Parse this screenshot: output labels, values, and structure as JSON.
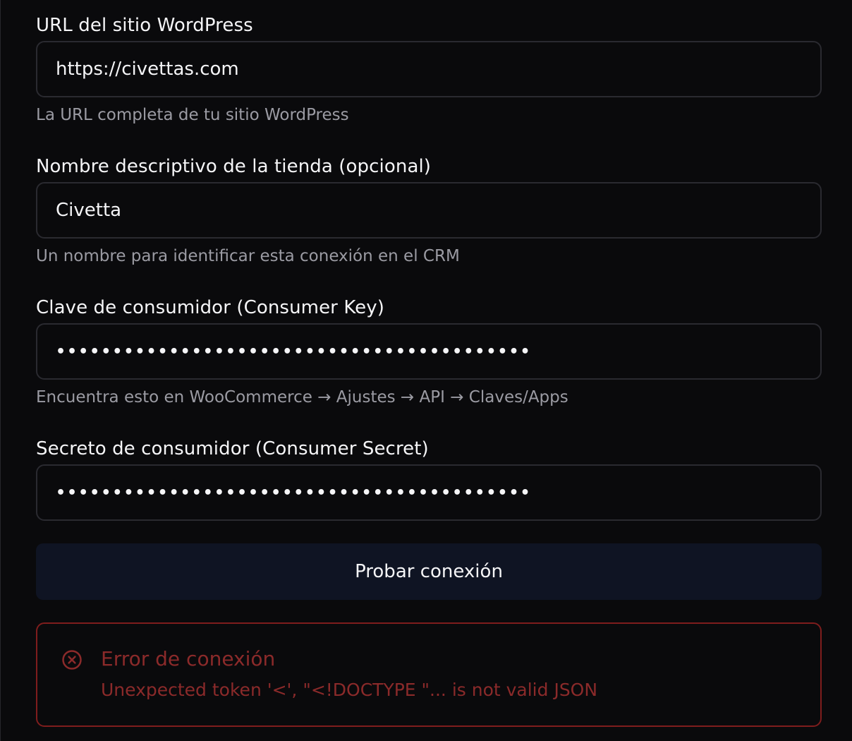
{
  "form": {
    "url": {
      "label": "URL del sitio WordPress",
      "value": "https://civettas.com",
      "hint": "La URL completa de tu sitio WordPress"
    },
    "store_name": {
      "label": "Nombre descriptivo de la tienda (opcional)",
      "value": "Civetta",
      "hint": "Un nombre para identificar esta conexión en el CRM"
    },
    "consumer_key": {
      "label": "Clave de consumidor (Consumer Key)",
      "value": "••••••••••••••••••••••••••••••••••••••••••",
      "hint": "Encuentra esto en WooCommerce → Ajustes → API → Claves/Apps"
    },
    "consumer_secret": {
      "label": "Secreto de consumidor (Consumer Secret)",
      "value": "••••••••••••••••••••••••••••••••••••••••••"
    },
    "test_button_label": "Probar conexión"
  },
  "error": {
    "icon": "x-circle-icon",
    "title": "Error de conexión",
    "message": "Unexpected token '<', \"<!DOCTYPE \"... is not valid JSON",
    "color": "#8b2a2a",
    "border_color": "#7f1d1d"
  },
  "colors": {
    "background": "#0a0a0c",
    "button_bg": "#0f1423",
    "input_border": "#2a2a30",
    "hint_text": "#9b9ba3"
  }
}
